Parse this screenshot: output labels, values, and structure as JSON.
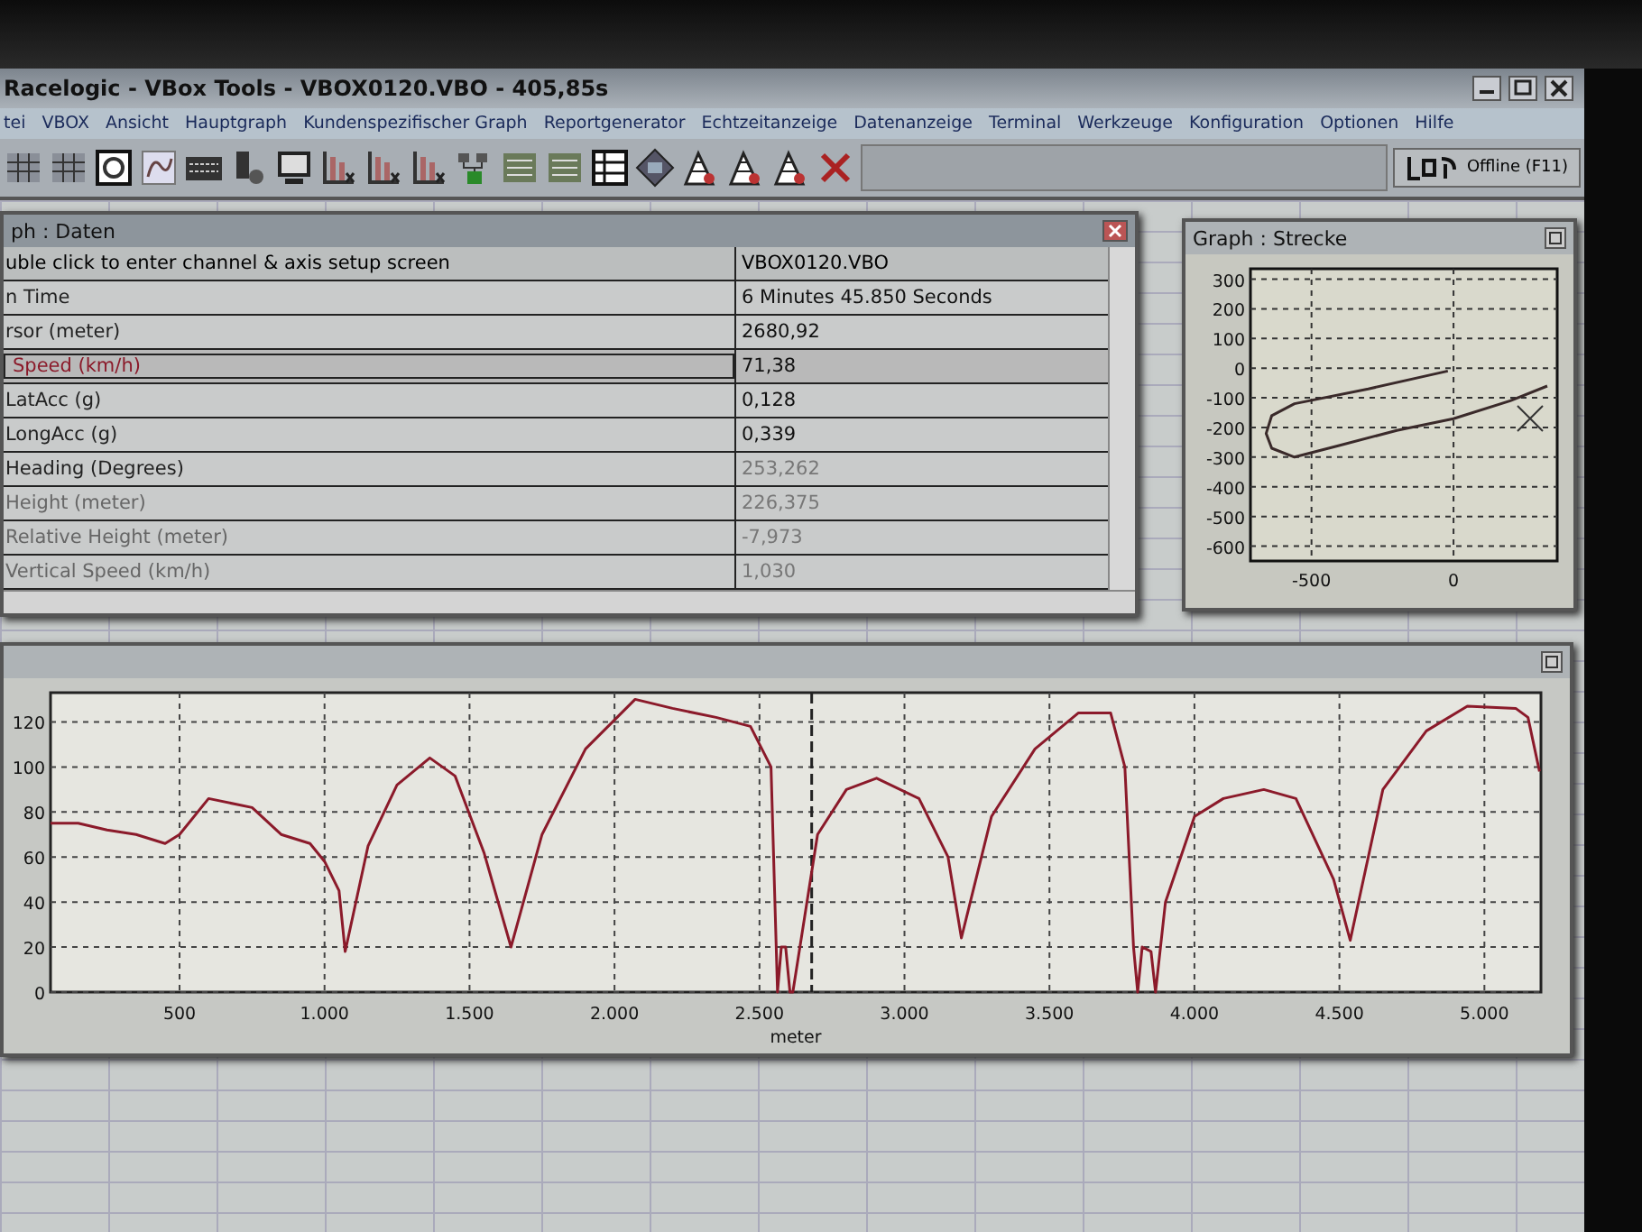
{
  "window": {
    "title": "Racelogic - VBox Tools - VBOX0120.VBO - 405,85s"
  },
  "menu": [
    "tei",
    "VBOX",
    "Ansicht",
    "Hauptgraph",
    "Kundenspezifischer Graph",
    "Reportgenerator",
    "Echtzeitanzeige",
    "Datenanzeige",
    "Terminal",
    "Werkzeuge",
    "Konfiguration",
    "Optionen",
    "Hilfe"
  ],
  "status": {
    "label": "Offline (F11)"
  },
  "data_panel": {
    "title": "ph : Daten",
    "header": [
      "uble click to enter channel & axis setup screen",
      "VBOX0120.VBO"
    ],
    "rows": [
      {
        "name": "n Time",
        "value": "6 Minutes 45.850 Seconds",
        "selected": false
      },
      {
        "name": "rsor (meter)",
        "value": "2680,92",
        "selected": false
      },
      {
        "name": "Speed (km/h)",
        "value": "71,38",
        "selected": true
      },
      {
        "name": "LatAcc (g)",
        "value": "0,128",
        "selected": false
      },
      {
        "name": "LongAcc (g)",
        "value": "0,339",
        "selected": false
      },
      {
        "name": "Heading (Degrees)",
        "value": "253,262",
        "selected": false
      },
      {
        "name": "Height (meter)",
        "value": "226,375",
        "selected": false
      },
      {
        "name": "Relative Height (meter)",
        "value": "-7,973",
        "selected": false
      },
      {
        "name": "Vertical Speed (km/h)",
        "value": "1,030",
        "selected": false
      }
    ]
  },
  "track_panel": {
    "title": "Graph : Strecke",
    "chart_data": {
      "type": "line",
      "xlim": [
        -715,
        365
      ],
      "ylim": [
        -650,
        335
      ],
      "xticks": [
        -500,
        0
      ],
      "yticks": [
        300,
        200,
        100,
        0,
        -100,
        -200,
        -300,
        -400,
        -500,
        -600
      ],
      "x": [
        -20,
        -300,
        -560,
        -640,
        -660,
        -640,
        -560,
        -400,
        -200,
        0,
        200,
        330
      ],
      "grid": true,
      "series": [
        {
          "color": "#3a2a2a",
          "values": [
            -10,
            -70,
            -120,
            -160,
            -220,
            -270,
            -300,
            -260,
            -210,
            -170,
            -110,
            -60
          ]
        }
      ]
    }
  },
  "main_graph": {
    "chart_data": {
      "type": "line",
      "xlabel": "meter",
      "xlim": [
        55,
        5195
      ],
      "ylim": [
        0,
        133
      ],
      "xticks": [
        {
          "value": 500,
          "label": "500"
        },
        {
          "value": 1000,
          "label": "1.000"
        },
        {
          "value": 1500,
          "label": "1.500"
        },
        {
          "value": 2000,
          "label": "2.000"
        },
        {
          "value": 2500,
          "label": "2.500"
        },
        {
          "value": 3000,
          "label": "3.000"
        },
        {
          "value": 3500,
          "label": "3.500"
        },
        {
          "value": 4000,
          "label": "4.000"
        },
        {
          "value": 4500,
          "label": "4.500"
        },
        {
          "value": 5000,
          "label": "5.000"
        }
      ],
      "yticks": [
        0,
        20,
        40,
        60,
        80,
        100,
        120
      ],
      "x": [
        55,
        150,
        250,
        350,
        450,
        500,
        600,
        750,
        850,
        950,
        1000,
        1050,
        1071,
        1150,
        1250,
        1363,
        1450,
        1550,
        1643,
        1750,
        1900,
        2071,
        2200,
        2350,
        2469,
        2540,
        2562,
        2575,
        2590,
        2605,
        2615,
        2700,
        2800,
        2904,
        3050,
        3150,
        3196,
        3300,
        3450,
        3600,
        3711,
        3760,
        3790,
        3804,
        3820,
        3850,
        3866,
        3900,
        4000,
        4100,
        4239,
        4350,
        4480,
        4537,
        4650,
        4800,
        4941,
        5108,
        5150,
        5190
      ],
      "grid": true,
      "ref_lines": [
        {
          "axis": "x",
          "value": 2680
        }
      ],
      "series": [
        {
          "color": "#8b1a2a",
          "values": [
            75,
            75,
            72,
            70,
            66,
            70,
            86,
            82,
            70,
            66,
            58,
            45,
            18,
            65,
            92,
            104,
            96,
            62,
            20,
            70,
            108,
            130,
            126,
            122,
            118,
            100,
            0,
            20,
            20,
            0,
            0,
            70,
            90,
            95,
            86,
            60,
            24,
            78,
            108,
            124,
            124,
            100,
            20,
            0,
            20,
            18,
            0,
            40,
            78,
            86,
            90,
            86,
            50,
            23,
            90,
            116,
            127,
            126,
            122,
            98
          ]
        }
      ]
    }
  }
}
